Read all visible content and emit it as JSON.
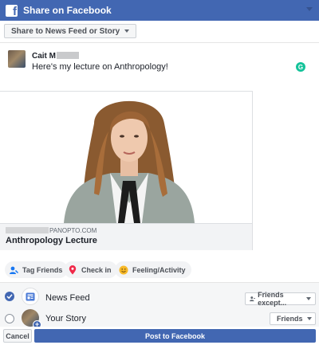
{
  "window": {
    "title": "Share on Facebook"
  },
  "destination": {
    "label": "Share to News Feed or Story"
  },
  "composer": {
    "author": "Cait M",
    "message": "Here's my lecture on Anthropology!",
    "grammarly_glyph": "G"
  },
  "link_preview": {
    "domain": "PANOPTO.COM",
    "title": "Anthropology Lecture"
  },
  "actions": [
    {
      "label": "Tag Friends",
      "icon": "tag-friends-icon"
    },
    {
      "label": "Check in",
      "icon": "location-pin-icon"
    },
    {
      "label": "Feeling/Activity",
      "icon": "smiley-icon"
    }
  ],
  "audience": {
    "news_feed": {
      "label": "News Feed",
      "checked": true,
      "privacy": "Friends except..."
    },
    "your_story": {
      "label": "Your Story",
      "checked": false,
      "privacy": "Friends"
    }
  },
  "footer": {
    "cancel_label": "Cancel",
    "post_label": "Post to Facebook"
  },
  "colors": {
    "brand": "#4267b2",
    "grammarly": "#15c39a",
    "checkin_pin": "#f02849",
    "feeling": "#f7b928",
    "tag": "#1877f2"
  }
}
